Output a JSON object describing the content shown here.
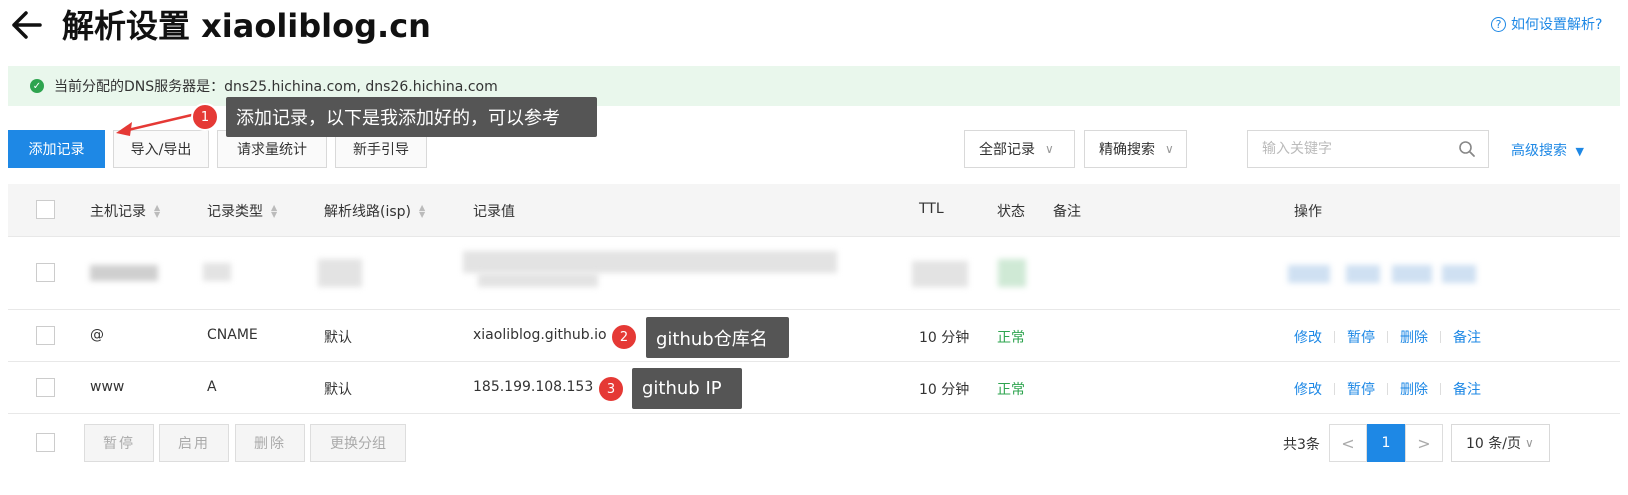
{
  "header": {
    "title": "解析设置 xiaoliblog.cn",
    "help_icon": "?",
    "help_text": "如何设置解析?"
  },
  "notice": {
    "icon": "check-circle-icon",
    "text": "当前分配的DNS服务器是：dns25.hichina.com, dns26.hichina.com"
  },
  "toolbar": {
    "add_record": "添加记录",
    "import_export": "导入/导出",
    "request_stats": "请求量统计",
    "guide": "新手引导",
    "filter_select": "全部记录",
    "match_select": "精确搜索",
    "search_placeholder": "输入关键字",
    "advanced_search": "高级搜索"
  },
  "table": {
    "headers": {
      "host": "主机记录",
      "type": "记录类型",
      "line": "解析线路(isp)",
      "value": "记录值",
      "ttl": "TTL",
      "status": "状态",
      "remark": "备注",
      "actions": "操作"
    },
    "rows": [
      {
        "host": "@",
        "type": "CNAME",
        "line": "默认",
        "value": "xiaoliblog.github.io",
        "ttl": "10 分钟",
        "status": "正常"
      },
      {
        "host": "www",
        "type": "A",
        "line": "默认",
        "value": "185.199.108.153",
        "ttl": "10 分钟",
        "status": "正常"
      }
    ],
    "row_actions": {
      "edit": "修改",
      "pause": "暂停",
      "delete": "删除",
      "remark": "备注"
    }
  },
  "footer": {
    "pause": "暂停",
    "enable": "启用",
    "delete": "删除",
    "change_group": "更换分组",
    "total": "共3条",
    "current_page": "1",
    "page_size": "10 条/页"
  },
  "annotations": [
    {
      "num": "1",
      "text": "添加记录，以下是我添加好的，可以参考"
    },
    {
      "num": "2",
      "text": "github仓库名"
    },
    {
      "num": "3",
      "text": "github IP"
    }
  ],
  "colors": {
    "primary": "#1e88e5",
    "success": "#2ea44f",
    "badge": "#e53935",
    "tooltip": "#555555"
  }
}
